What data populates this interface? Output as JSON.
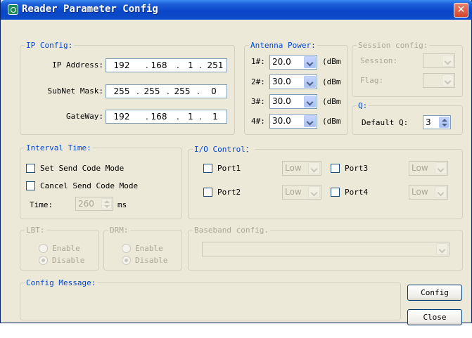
{
  "window": {
    "title": "Reader Parameter Config",
    "close_glyph": "✕"
  },
  "ip_config": {
    "legend": "IP Config:",
    "ip_label": "IP Address:",
    "ip": [
      "192",
      "168",
      "1",
      "251"
    ],
    "mask_label": "SubNet Mask:",
    "mask": [
      "255",
      "255",
      "255",
      "0"
    ],
    "gateway_label": "GateWay:",
    "gateway": [
      "192",
      "168",
      "1",
      "1"
    ],
    "dot": "."
  },
  "antenna": {
    "legend": "Antenna Power:",
    "unit": "(dBm",
    "rows": [
      {
        "label": "1#:",
        "value": "20.0"
      },
      {
        "label": "2#:",
        "value": "30.0"
      },
      {
        "label": "3#:",
        "value": "30.0"
      },
      {
        "label": "4#:",
        "value": "30.0"
      }
    ]
  },
  "session": {
    "legend": "Session config:",
    "session_label": "Session:",
    "flag_label": "Flag:"
  },
  "q": {
    "legend": "Q:",
    "default_label": "Default Q:",
    "value": "3"
  },
  "interval": {
    "legend": "Interval Time:",
    "set_label": "Set Send Code Mode",
    "cancel_label": "Cancel Send Code Mode",
    "time_label": "Time:",
    "time_value": "260",
    "time_unit": "ms"
  },
  "io": {
    "legend": "I/O Control：",
    "ports": [
      {
        "label": "Port1",
        "level": "Low"
      },
      {
        "label": "Port2",
        "level": "Low"
      },
      {
        "label": "Port3",
        "level": "Low"
      },
      {
        "label": "Port4",
        "level": "Low"
      }
    ]
  },
  "lbt": {
    "legend": "LBT:",
    "enable": "Enable",
    "disable": "Disable",
    "selected": "Disable"
  },
  "drm": {
    "legend": "DRM:",
    "enable": "Enable",
    "disable": "Disable",
    "selected": "Disable"
  },
  "baseband": {
    "legend": "Baseband config."
  },
  "message": {
    "legend": "Config Message:"
  },
  "buttons": {
    "config": "Config",
    "close": "Close"
  }
}
